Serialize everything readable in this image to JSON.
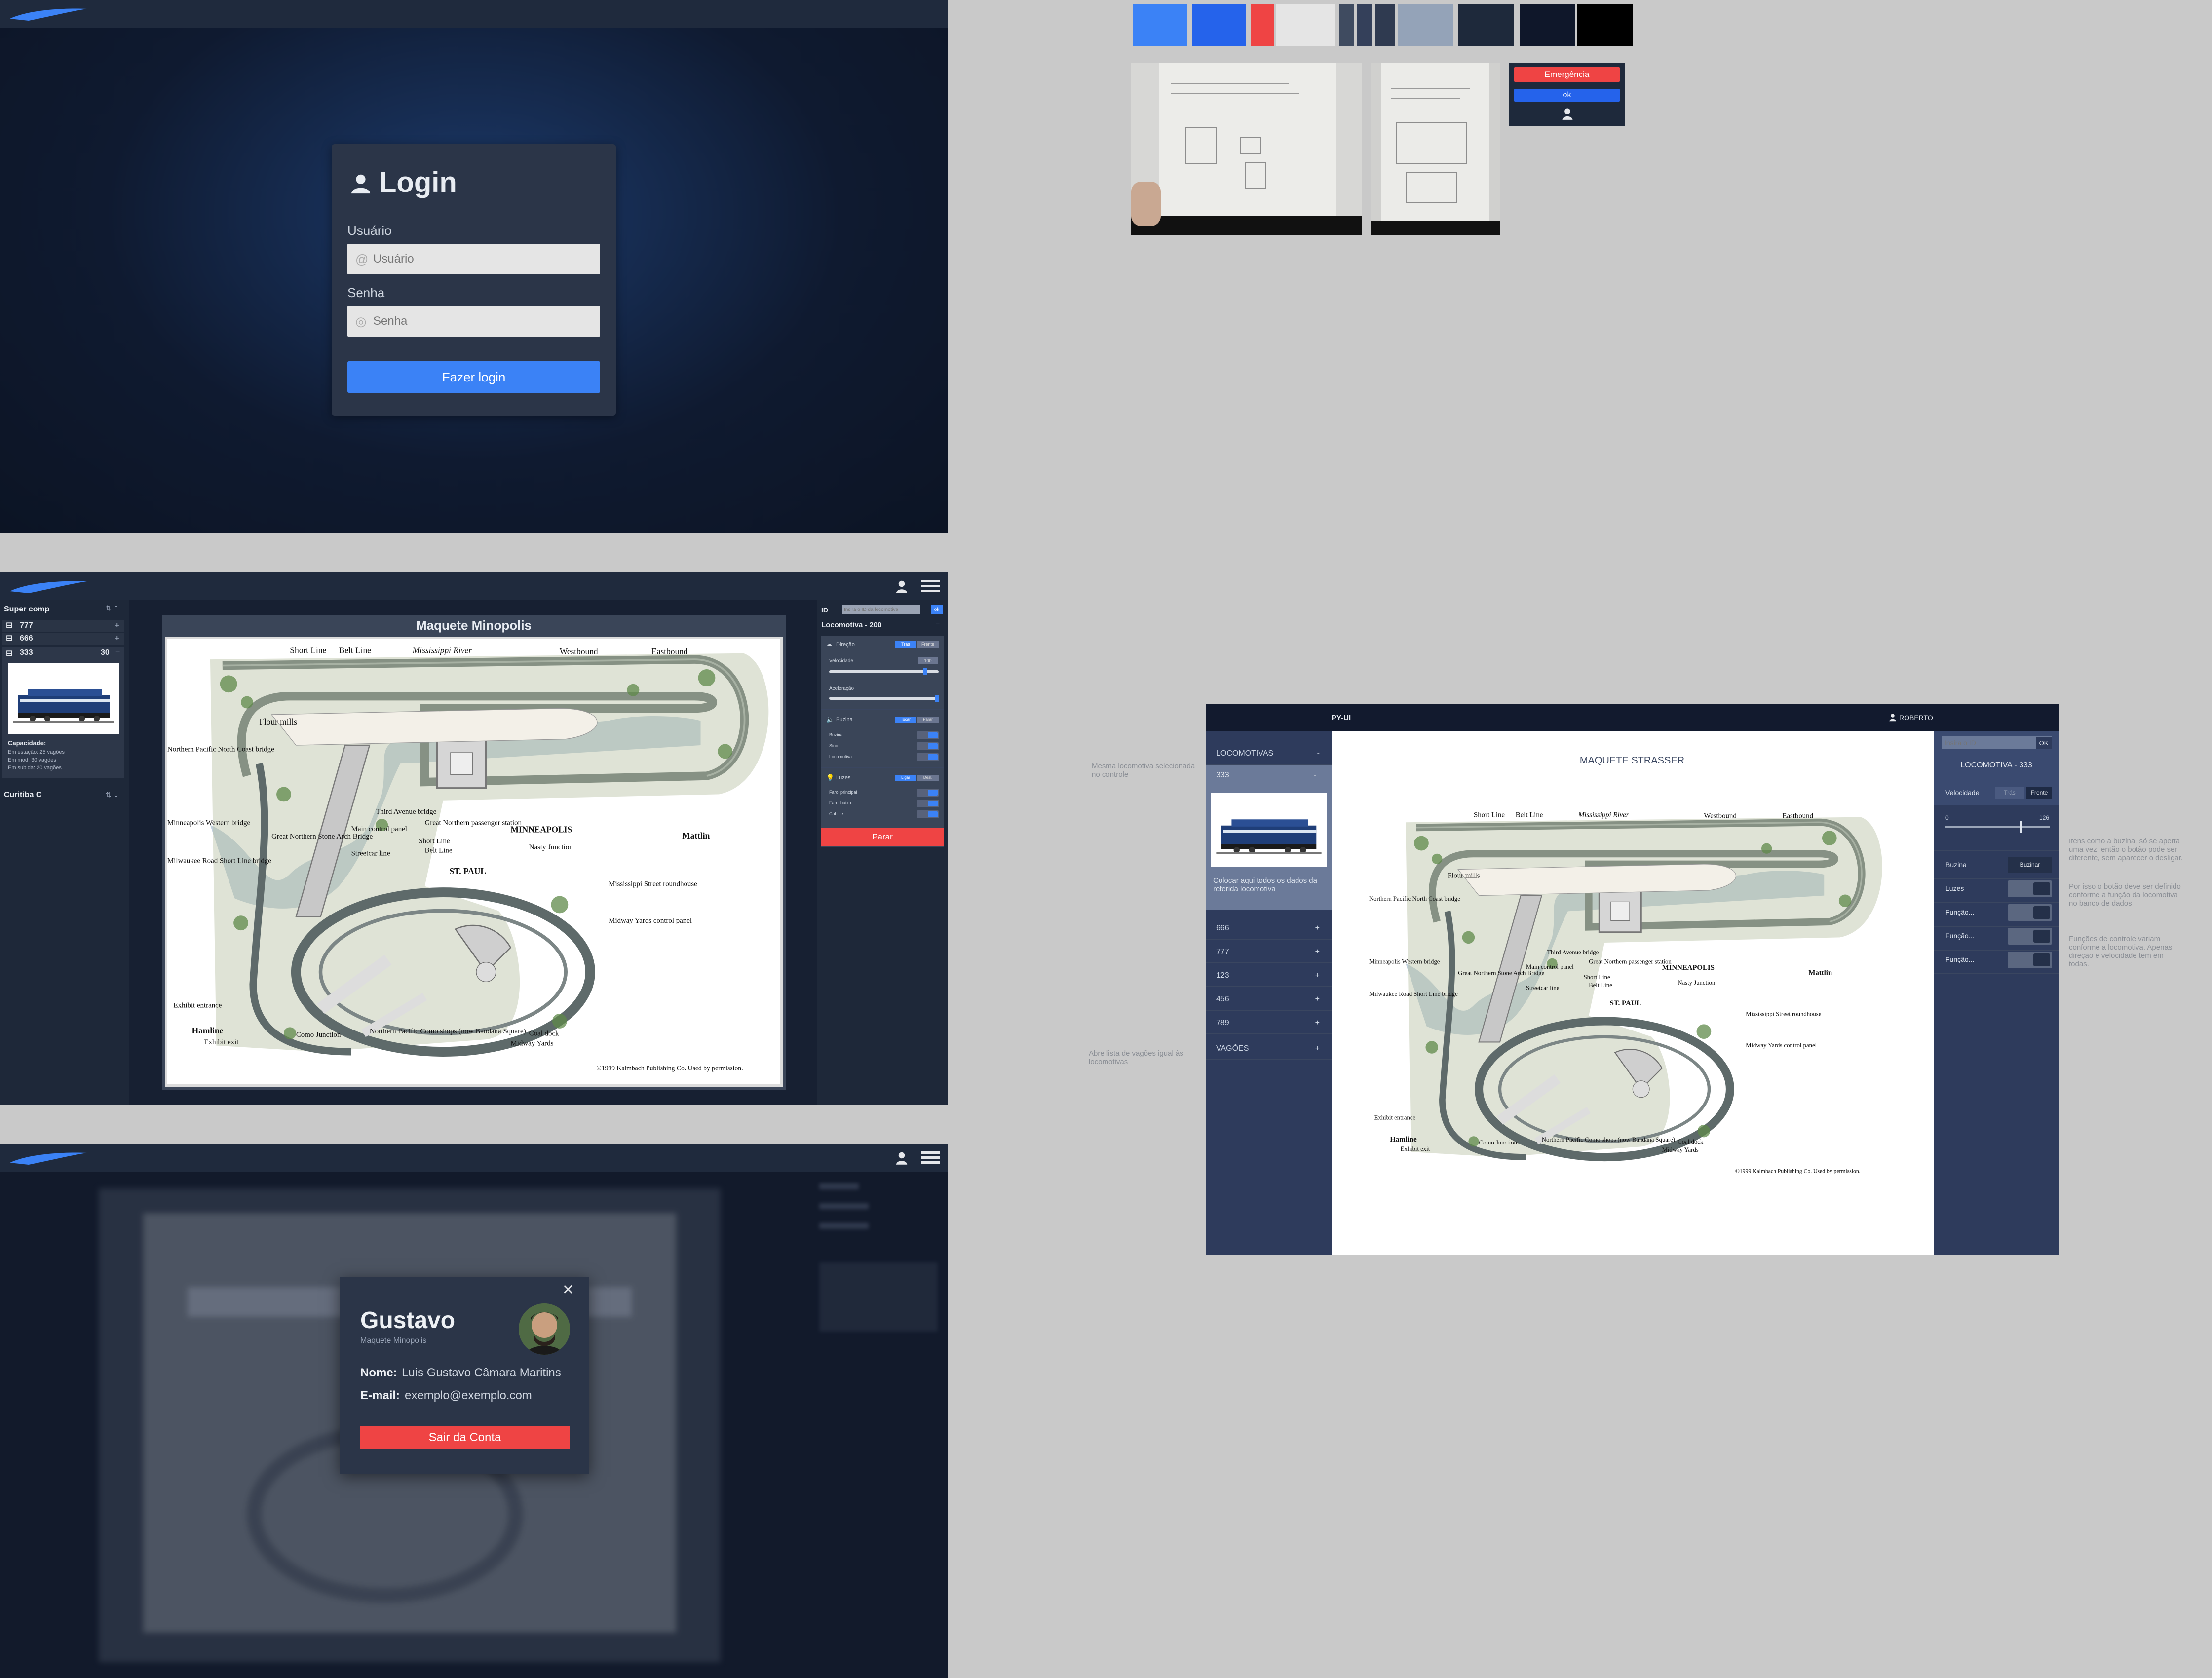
{
  "palette": [
    "#3b82f6",
    "#2563eb",
    "#ef4444",
    "#e5e5e5",
    "#3f4b60",
    "#94a3b8",
    "#1e293b",
    "#0f172a",
    "#000000"
  ],
  "login": {
    "title": "Login",
    "user_label": "Usuário",
    "user_placeholder": "Usuário",
    "pass_label": "Senha",
    "pass_placeholder": "Senha",
    "submit": "Fazer login"
  },
  "mini_widget": {
    "emergency": "Emergência",
    "ok": "ok"
  },
  "control": {
    "sidebar": {
      "group1": "Super comp",
      "items": [
        {
          "id": "777"
        },
        {
          "id": "666"
        },
        {
          "id": "333",
          "count": "30"
        }
      ],
      "capacity_title": "Capacidade:",
      "capacity_lines": [
        "Em estação: 25 vagões",
        "Em mod: 30 vagões",
        "Em subida: 20 vagões"
      ],
      "group2": "Curitiba C"
    },
    "map_title": "Maquete Minopolis",
    "right": {
      "id_label": "ID",
      "id_placeholder": "Insira o ID da locomotiva",
      "ok": "ok",
      "loco_title": "Locomotiva - 200",
      "direction_label": "Direção",
      "dir_back": "Trás",
      "dir_front": "Frente",
      "speed_label": "Velocidade",
      "speed_value": "100",
      "accel_label": "Aceleração",
      "horn_label": "Buzina",
      "horn_btn1": "Tocar",
      "horn_btn2": "Parar",
      "horn_rows": [
        "Buzina",
        "Sino",
        "Locomotiva"
      ],
      "lights_label": "Luzes",
      "lights_btn1": "Ligar",
      "lights_btn2": "Desl.",
      "light_rows": [
        "Farol principal",
        "Farol baixo",
        "Cabine"
      ],
      "stop": "Parar"
    }
  },
  "profile": {
    "name": "Gustavo",
    "subtitle": "Maquete Minopolis",
    "nome_label": "Nome:",
    "nome_value": "Luis Gustavo Câmara Maritins",
    "email_label": "E-mail:",
    "email_value": "exemplo@exemplo.com",
    "logout": "Sair da Conta"
  },
  "map": {
    "labels": {
      "short_line": "Short Line",
      "belt_line": "Belt Line",
      "mississippi_river": "Mississippi River",
      "westbound": "Westbound",
      "eastbound": "Eastbound",
      "flour_mills": "Flour mills",
      "northern_pacific": "Northern Pacific North Coast bridge",
      "third_ave": "Third Avenue bridge",
      "great_northern_station": "Great Northern passenger station",
      "minneapolis": "MINNEAPOLIS",
      "mattlin": "Mattlin",
      "st_anthony": "Saint Anthony Falls",
      "minneapolis_western": "Minneapolis Western bridge",
      "stone_arch": "Great Northern Stone Arch Bridge",
      "main_control": "Main control panel",
      "streetcar": "Streetcar line",
      "short_line2": "Short Line",
      "belt_line2": "Belt Line",
      "nasty": "Nasty Junction",
      "milwaukee": "Milwaukee Road Short Line bridge",
      "st_paul": "ST. PAUL",
      "roundhouse": "Mississippi Street roundhouse",
      "midway_panel": "Midway Yards control panel",
      "exhibit_entrance": "Exhibit entrance",
      "hamline": "Hamline",
      "exhibit_exit": "Exhibit exit",
      "como_junction": "Como Junction",
      "np_como": "Northern Pacific Como shops (now Bandana Square)",
      "coal_dock": "Coal dock",
      "midway_yards": "Midway Yards",
      "copyright": "©1999 Kalmbach Publishing Co. Used by permission."
    }
  },
  "wire": {
    "app_name": "PY-UI",
    "user": "ROBERTO",
    "loco_header": "LOCOMOTIVAS",
    "loco_header_icon": "-",
    "selected": "333",
    "selected_icon": "-",
    "desc": "Colocar aqui todos os dados da referida locomotiva",
    "items": [
      "666",
      "777",
      "123",
      "456",
      "789"
    ],
    "wagons": "VAGÕES",
    "map_title": "MAQUETE STRASSER",
    "id_placeholder": "Insira o ID",
    "ok": "OK",
    "loco_title": "LOCOMOTIVA - 333",
    "speed_label": "Velocidade",
    "dir_back": "Trás",
    "dir_front": "Frente",
    "slider_min": "0",
    "slider_max": "126",
    "horn_label": "Buzina",
    "horn_btn": "Buzinar",
    "lights_label": "Luzes",
    "func_labels": [
      "Função...",
      "Função...",
      "Função..."
    ]
  },
  "notes": {
    "left1": "Mesma locomotiva selecionada no controle",
    "left2": "Abre lista de vagões igual às locomotivas",
    "right1": "Itens como a buzina, só se aperta uma vez, então o botão pode ser diferente, sem aparecer o desligar.",
    "right2": "Por isso o botão deve ser definido conforme a função da locomotiva no banco de dados",
    "right3": "Funções de controle variam conforme a locomotiva. Apenas direção e velocidade tem em todas."
  }
}
